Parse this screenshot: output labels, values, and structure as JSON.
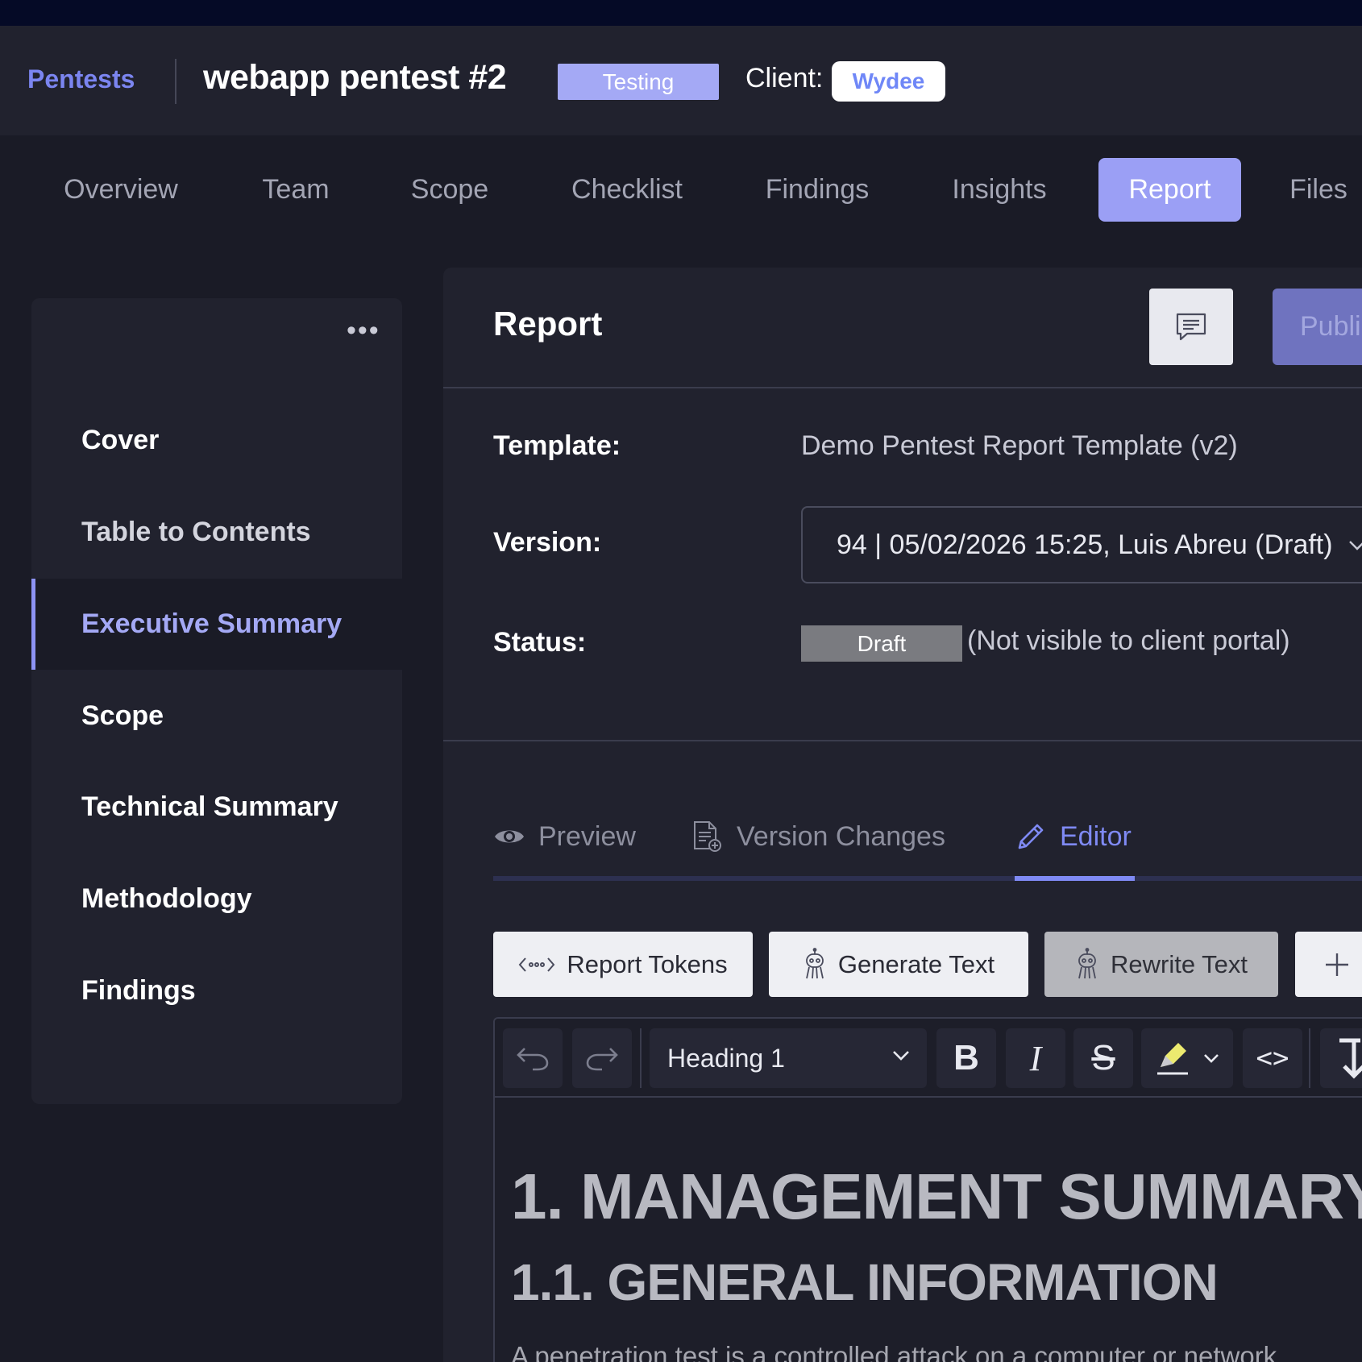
{
  "header": {
    "breadcrumb": "Pentests",
    "title": "webapp pentest #2",
    "state": "Testing",
    "client_label": "Client:",
    "client": "Wydee"
  },
  "tabs": [
    {
      "label": "Overview"
    },
    {
      "label": "Team"
    },
    {
      "label": "Scope"
    },
    {
      "label": "Checklist"
    },
    {
      "label": "Findings"
    },
    {
      "label": "Insights"
    },
    {
      "label": "Report",
      "active": true
    },
    {
      "label": "Files"
    }
  ],
  "sidebar": {
    "menu_icon": "more-horizontal-icon",
    "items": [
      {
        "label": "Cover"
      },
      {
        "label": "Table to Contents"
      },
      {
        "label": "Executive Summary",
        "active": true
      },
      {
        "label": "Scope"
      },
      {
        "label": "Technical Summary"
      },
      {
        "label": "Methodology"
      },
      {
        "label": "Findings"
      }
    ]
  },
  "report": {
    "title": "Report",
    "comment_icon": "comment-icon",
    "publish_label": "Publi",
    "template_label": "Template:",
    "template_value": "Demo Pentest Report Template (v2)",
    "version_label": "Version:",
    "version_value": "94 | 05/02/2026 15:25, Luis Abreu (Draft)",
    "status_label": "Status:",
    "status_value": "Draft",
    "status_note": "(Not visible to client portal)"
  },
  "subtabs": [
    {
      "label": "Preview",
      "icon": "eye-icon"
    },
    {
      "label": "Version Changes",
      "icon": "document-add-icon"
    },
    {
      "label": "Editor",
      "icon": "pencil-icon",
      "active": true
    }
  ],
  "actions": {
    "report_tokens": "Report Tokens",
    "generate_text": "Generate Text",
    "rewrite_text": "Rewrite Text",
    "add_icon": "plus-icon"
  },
  "editor": {
    "block_type": "Heading 1",
    "bold_label": "B",
    "italic_label": "I",
    "strike_label": "S",
    "code_label": "<>",
    "content": {
      "h1": "1. MANAGEMENT SUMMARY",
      "h2": "1.1. GENERAL INFORMATION",
      "paragraph": "A penetration test is a controlled attack on a computer or network"
    }
  },
  "colors": {
    "accent": "#9b9ff5",
    "link": "#7b85f0",
    "background": "#1a1b26",
    "panel": "#21222e"
  }
}
